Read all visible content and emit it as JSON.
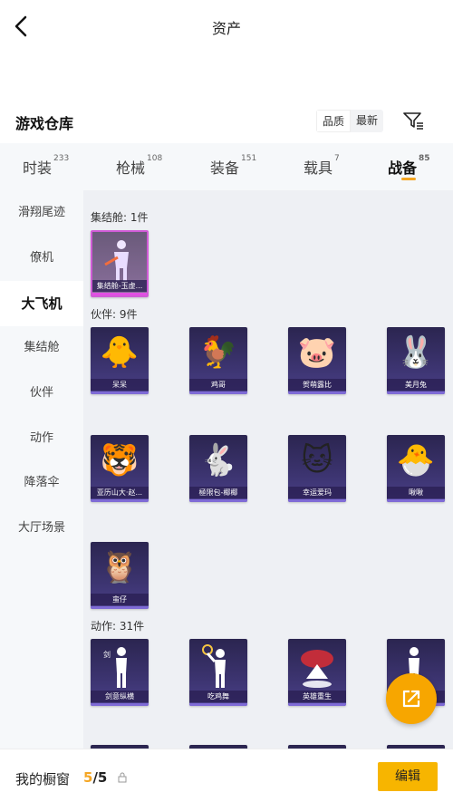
{
  "header": {
    "title": "资产"
  },
  "warehouse": {
    "title": "游戏仓库",
    "sort": [
      "品质",
      "最新"
    ]
  },
  "tabs": [
    {
      "label": "时装",
      "count": "233"
    },
    {
      "label": "枪械",
      "count": "108"
    },
    {
      "label": "装备",
      "count": "151"
    },
    {
      "label": "载具",
      "count": "7"
    },
    {
      "label": "战备",
      "count": "85"
    }
  ],
  "sidebar": [
    "滑翔尾迹",
    "僚机",
    "大飞机",
    "集结舱",
    "伙伴",
    "动作",
    "降落伞",
    "大厅场景"
  ],
  "sections": {
    "capsule": {
      "label": "集结舱: 1件",
      "items": [
        "集结舱-玉虚..."
      ]
    },
    "partners": {
      "label": "伙伴: 9件",
      "items": [
        "呆呆",
        "鸡哥",
        "贺萌露比",
        "美月兔",
        "亚历山大·赵...",
        "極限包-椰椰",
        "幸运爱玛",
        "啾啾",
        "蛮仔"
      ]
    },
    "actions": {
      "label": "动作: 31件",
      "items": [
        "剑意纵横",
        "吃鸡舞",
        "英雄重生",
        ""
      ]
    }
  },
  "bottom": {
    "label": "我的橱窗",
    "current": "5",
    "total": "/5",
    "edit": "编辑"
  },
  "colors": {
    "accent": "#f7a600",
    "card": "#3c3470"
  }
}
